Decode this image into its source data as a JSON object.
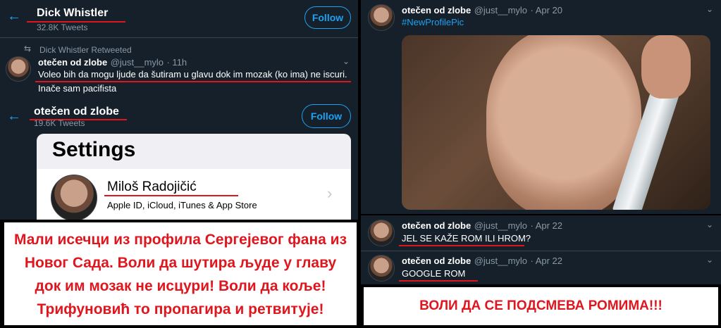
{
  "panel1": {
    "back_icon": "arrow-left-icon",
    "profile_name": "Dick Whistler",
    "tweet_count": "32.8K Tweets",
    "follow_label": "Follow",
    "retweet_icon": "retweet-icon",
    "retweet_label": "Dick Whistler Retweeted",
    "tweet_name": "otečen od zlobe",
    "tweet_handle": "@just__mylo",
    "tweet_time": "· 11h",
    "tweet_line1": "Voleo bih da mogu ljude da šutiram u glavu dok im mozak (ko ima) ne iscuri.",
    "tweet_line2": "Inače sam pacifista"
  },
  "panel2": {
    "back_icon": "arrow-left-icon",
    "profile_name": "otečen od zlobe",
    "tweet_count": "19.6K Tweets",
    "follow_label": "Follow",
    "settings_title": "Settings",
    "user_name": "Miloš Radojičić",
    "user_sub": "Apple ID, iCloud, iTunes & App Store"
  },
  "panel3": {
    "name": "otečen od zlobe",
    "handle": "@just__mylo",
    "time": "· Apr 20",
    "hashtag": "#NewProfilePic"
  },
  "panel4": {
    "tweet1": {
      "name": "otečen od zlobe",
      "handle": "@just__mylo",
      "time": "· Apr 22",
      "text": "JEL SE KAŽE ROM ILI HROM?"
    },
    "tweet2": {
      "name": "otečen od zlobe",
      "handle": "@just__mylo",
      "time": "· Apr 22",
      "text": "GOOGLE ROM"
    }
  },
  "captions": {
    "left_line1": "Мали исечци из профила Сергејевог фана из",
    "left_line2": "Новог Сада. Воли да шутира људе у главу",
    "left_line3": "док им мозак не исцури! Воли да коље!",
    "left_line4": "Трифуновић то пропагира и ретвитује!",
    "right": "ВОЛИ ДА СЕ ПОДСМЕВА РОМИМА!!!"
  },
  "colors": {
    "twitter_dark": "#15202b",
    "twitter_blue": "#1da1f2",
    "muted": "#8899a6",
    "annotation_red": "#e0161e"
  }
}
